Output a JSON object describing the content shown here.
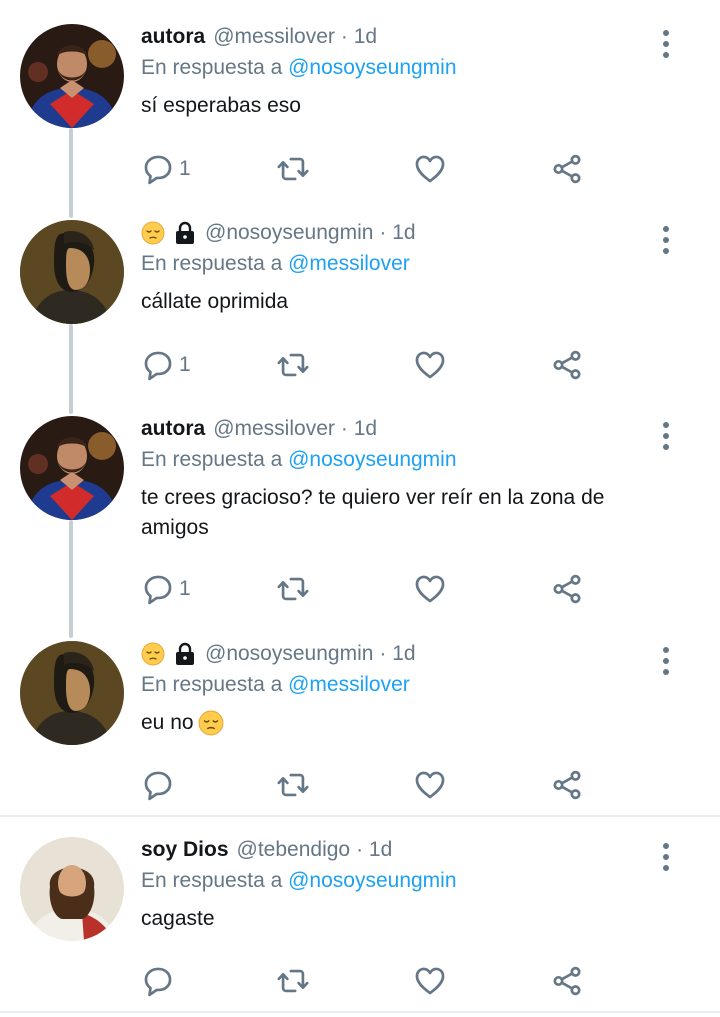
{
  "tweets": [
    {
      "name": "autora",
      "has_icons": false,
      "handle": "@messilover",
      "time": "· 1d",
      "reply_prefix": "En respuesta a",
      "reply_to": "@nosoyseungmin",
      "text": "sí esperabas eso",
      "text_emoji": false,
      "reply_count": "1",
      "avatar": "man-hands-heart-avatar"
    },
    {
      "name": "",
      "has_icons": true,
      "handle": "@nosoyseungmin",
      "time": "· 1d",
      "reply_prefix": "En respuesta a",
      "reply_to": "@messilover",
      "text": "cállate oprimida",
      "text_emoji": false,
      "reply_count": "1",
      "avatar": "renaissance-portrait-avatar"
    },
    {
      "name": "autora",
      "has_icons": false,
      "handle": "@messilover",
      "time": "· 1d",
      "reply_prefix": "En respuesta a",
      "reply_to": "@nosoyseungmin",
      "text": "te crees gracioso? te quiero ver reír en la zona de amigos",
      "text_emoji": false,
      "reply_count": "1",
      "avatar": "man-hands-heart-avatar"
    },
    {
      "name": "",
      "has_icons": true,
      "handle": "@nosoyseungmin",
      "time": "· 1d",
      "reply_prefix": "En respuesta a",
      "reply_to": "@messilover",
      "text": "eu no",
      "text_emoji": true,
      "reply_count": "",
      "avatar": "renaissance-portrait-avatar"
    },
    {
      "name": "soy Dios",
      "has_icons": false,
      "handle": "@tebendigo",
      "time": "· 1d",
      "reply_prefix": "En respuesta a",
      "reply_to": "@nosoyseungmin",
      "text": "cagaste",
      "text_emoji": false,
      "reply_count": "",
      "avatar": "jesus-portrait-avatar"
    }
  ],
  "icons": {
    "name_emoji": "pensive-face-icon",
    "name_lock": "lock-icon",
    "reply": "reply-icon",
    "retweet": "retweet-icon",
    "like": "heart-icon",
    "share": "share-icon",
    "more": "more-options-icon"
  },
  "colors": {
    "mention": "#1da1f2",
    "secondary_text": "#657786",
    "thread_line": "#c4cfd6"
  }
}
